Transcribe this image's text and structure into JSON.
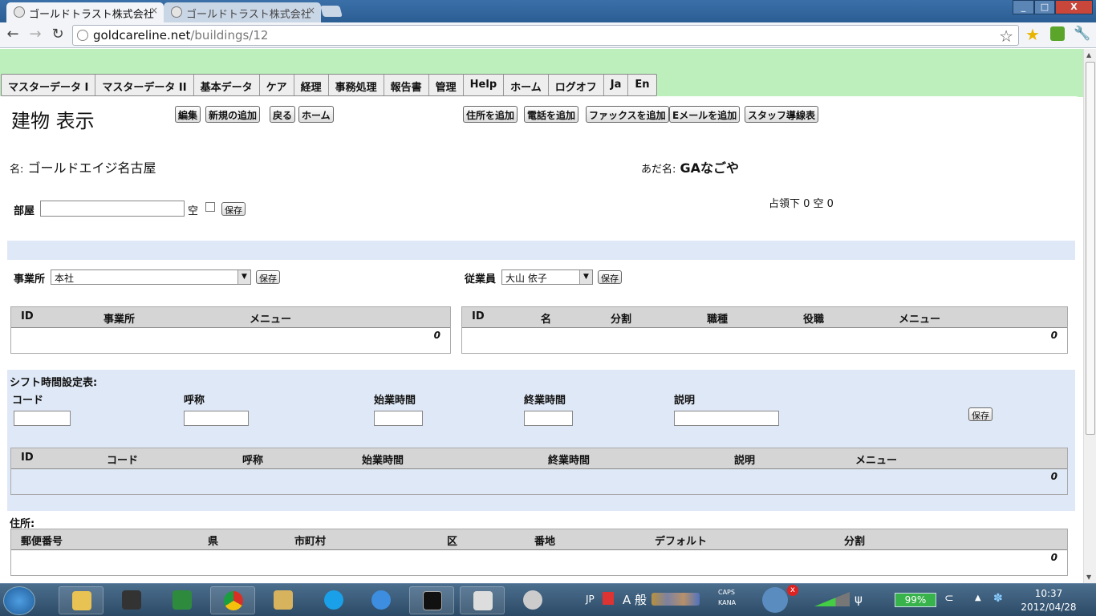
{
  "browser": {
    "tabs": [
      {
        "title": "ゴールドトラスト株式会社",
        "active": true
      },
      {
        "title": "ゴールドトラスト株式会社",
        "active": false
      }
    ],
    "close_glyph": "×",
    "url_host": "goldcareline.net",
    "url_path": "/buildings/12",
    "nav": {
      "back": "←",
      "forward": "→",
      "reload": "↻"
    },
    "star_glyph": "☆",
    "wrench_glyph": "🔧"
  },
  "menu": [
    "マスターデータ I",
    "マスターデータ II",
    "基本データ",
    "ケア",
    "経理",
    "事務処理",
    "報告書",
    "管理",
    "Help",
    "ホーム",
    "ログオフ",
    "Ja",
    "En"
  ],
  "page_title": "建物 表示",
  "actions_left": [
    "編集",
    "新規の追加",
    "戻る",
    "ホーム"
  ],
  "actions_right": [
    "住所を追加",
    "電話を追加",
    "ファックスを追加",
    "Eメールを追加",
    "スタッフ導線表"
  ],
  "building": {
    "name_label": "名:",
    "name": "ゴールドエイジ名古屋",
    "nickname_label": "あだ名:",
    "nickname": "GAなごや",
    "occupancy": "占領下 0 空 0"
  },
  "room": {
    "label": "部屋",
    "empty_label": "空",
    "save": "保存"
  },
  "office": {
    "label": "事業所",
    "selected": "本社",
    "save": "保存"
  },
  "employee": {
    "label": "従業員",
    "selected": "大山 依子",
    "save": "保存"
  },
  "office_table": {
    "headers": [
      "ID",
      "事業所",
      "メニュー"
    ],
    "count": "0"
  },
  "employee_table": {
    "headers": [
      "ID",
      "名",
      "分割",
      "職種",
      "役職",
      "メニュー"
    ],
    "count": "0"
  },
  "shift": {
    "title": "シフト時間設定表:",
    "field_labels": [
      "コード",
      "呼称",
      "始業時間",
      "終業時間",
      "説明"
    ],
    "save": "保存",
    "table_headers": [
      "ID",
      "コード",
      "呼称",
      "始業時間",
      "終業時間",
      "説明",
      "メニュー"
    ],
    "count": "0"
  },
  "address": {
    "title": "住所:",
    "table_headers": [
      "郵便番号",
      "県",
      "市町村",
      "区",
      "番地",
      "デフォルト",
      "分割"
    ],
    "count": "0"
  },
  "taskbar": {
    "lang": "JP",
    "ime": "A 般",
    "caps": "CAPS",
    "kana": "KANA",
    "battery": "99%",
    "time": "10:37",
    "date": "2012/04/28",
    "colors": {
      "taskbar": "#2c4a66",
      "page_band": "#bdefbd",
      "section_band": "#dfe8f6"
    }
  }
}
